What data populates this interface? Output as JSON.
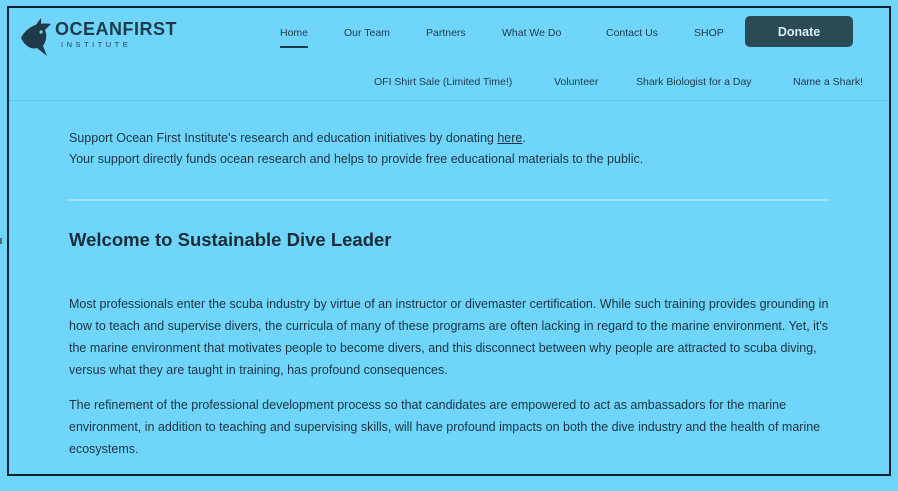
{
  "brand": {
    "name": "OCEANFIRST",
    "sub": "INSTITUTE"
  },
  "nav": {
    "primary": [
      "Home",
      "Our Team",
      "Partners",
      "What We Do",
      "Contact Us",
      "SHOP"
    ],
    "secondary": [
      "OFI Shirt Sale (Limited Time!)",
      "Volunteer",
      "Shark Biologist for a Day",
      "Name a Shark!"
    ],
    "donate_label": "Donate"
  },
  "support": {
    "line1_prefix": "Support Ocean First Institute's research and education initiatives by donating ",
    "link": "here",
    "line1_suffix": ".",
    "line2": "Your support directly funds ocean research and helps to provide free educational materials to the public."
  },
  "main": {
    "title": "Welcome to Sustainable Dive Leader",
    "paragraph1": "Most professionals enter the scuba industry by virtue of an instructor or divemaster certification. While such training provides grounding in how to teach and supervise divers, the curricula of many of these programs are often lacking in regard to the marine environment. Yet, it's the marine environment that motivates people to become divers, and this disconnect between why people are attracted to scuba diving, versus what they are taught in training, has profound consequences.",
    "paragraph2": "The refinement of the professional development process so that candidates are empowered to act as ambassadors for the marine environment, in addition to teaching and supervising skills, will have profound impacts on both the dive industry and the health of marine ecosystems."
  },
  "colors": {
    "background": "#6fd5fb",
    "donate_button": "#2a4a55",
    "text": "#1c3441"
  },
  "icons": {
    "logo": "shark-logo-icon"
  }
}
